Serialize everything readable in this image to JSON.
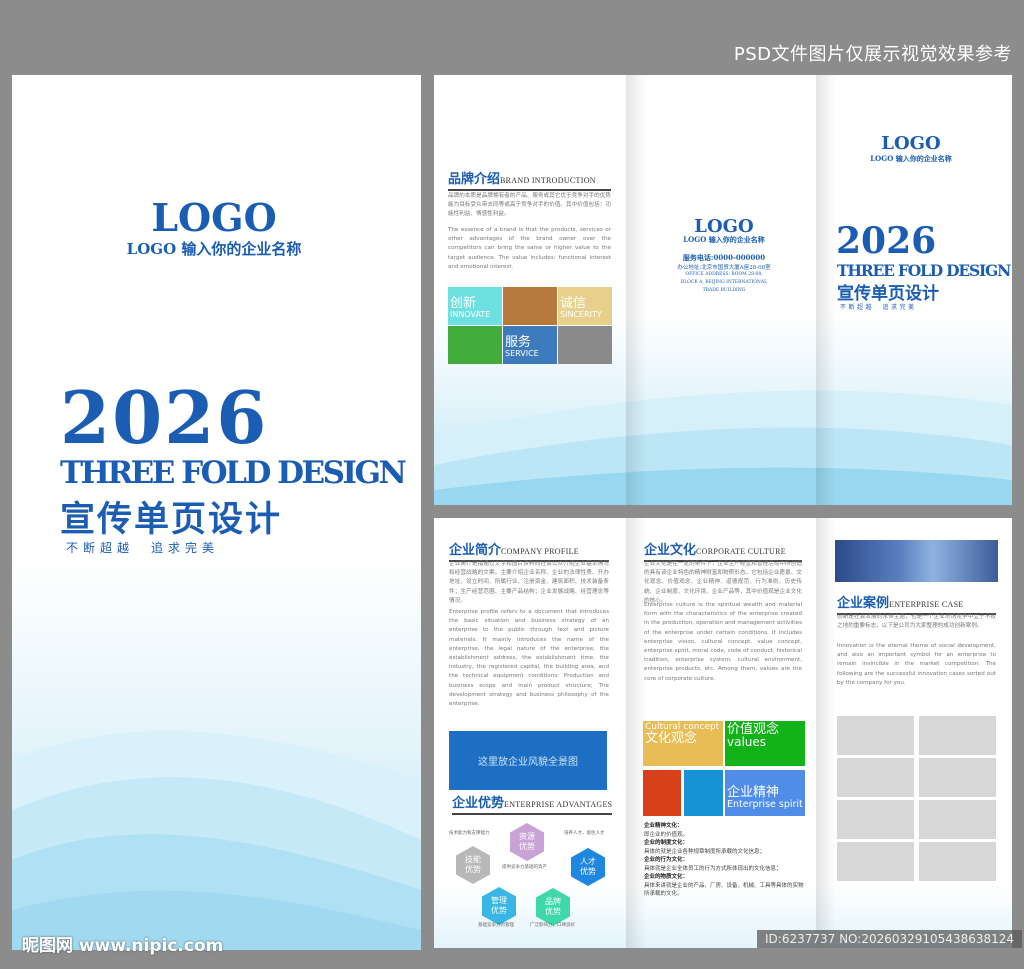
{
  "notice": "PSD文件图片仅展示视觉效果参考",
  "cover": {
    "logo": "LOGO",
    "company": "LOGO 输入你的企业名称",
    "year": "2026",
    "title_en": "THREE FOLD DESIGN",
    "title_cn": "宣传单页设计",
    "slogan": "不断超越　追求完美"
  },
  "outside": {
    "brand": {
      "title": "品牌介绍",
      "title_en": "BRAND INTRODUCTION",
      "text_cn": "品牌的本质是品牌拥有者的产品、服务或其它优于竞争对手的优势能为目标受众带去同等或高于竞争对手的价值。其中价值包括：功能性利益、情感性利益。",
      "text_en": "The essence of a brand is that the products, services or other advantages of the brand owner over the competitors can bring the same or higher value to the target audience. The value includes: functional interest and emotional interest.",
      "tiles": [
        {
          "cn": "创新",
          "en": "INNOVATE",
          "color": "#6fe0e2"
        },
        {
          "cn": "",
          "en": "",
          "color": "#b57a3c"
        },
        {
          "cn": "诚信",
          "en": "SINCERITY",
          "color": "#e6d08c"
        },
        {
          "cn": "",
          "en": "",
          "color": "#43ac3c"
        },
        {
          "cn": "服务",
          "en": "SERVICE",
          "color": "#3d7bbd"
        },
        {
          "cn": "",
          "en": "",
          "color": "#8a8a8a"
        }
      ]
    },
    "back": {
      "logo": "LOGO",
      "company": "LOGO 输入你的企业名称",
      "phone": "服务电话:0000-000000",
      "address_cn": "办公地址:北京市国贸大厦A座28-08室",
      "address_en": [
        "OFFICE ADDRESS: ROOM 28-08,",
        "BLOCK A, BEIJING INTERNATIONAL",
        "TRADE BUILDING"
      ]
    },
    "front": {
      "logo": "LOGO",
      "company": "LOGO 输入你的企业名称",
      "year": "2026",
      "title_en": "THREE FOLD DESIGN",
      "title_cn": "宣传单页设计",
      "slogan": "不断超越　追求完美"
    }
  },
  "inside": {
    "profile": {
      "title": "企业简介",
      "title_en": "COMPANY PROFILE",
      "text_cn": "企业简介是指通过文字和图片资料向社会公众介绍企业基本情况和经营战略的文案。主要介绍企业名称、企业的法律性质、开办地址、设立时间、所属行业、注册资金、建筑面积、技术装备条件；生产经营范围、主要产品结构；企业发展战略、经营理念等情况。",
      "text_en": "Enterprise profile refers to a document that introduces the basic situation and business strategy of an enterprise to the public through text and picture materials. It mainly introduces the name of the enterprise, the legal nature of the enterprise, the establishment address, the establishment time, the industry, the registered capital, the building area, and the technical equipment conditions; Production and business scope and main product structure; The development strategy and business philosophy of the enterprise.",
      "image_placeholder": "这里放企业风貌全景图"
    },
    "advantages": {
      "title": "企业优势",
      "title_en": "ENTERPRISE ADVANTAGES",
      "items": [
        {
          "label": "技能\n优势",
          "caption": "技术能力和支撑能力",
          "color": "#b8b8b8"
        },
        {
          "label": "资源\n优势",
          "caption": "提供竞争力基础的资产",
          "color": "#c9a3d6"
        },
        {
          "label": "人才\n优势",
          "caption": "培养人才，留住人才",
          "color": "#1e87e0"
        },
        {
          "label": "管理\n优势",
          "caption": "基础竞争力的管理",
          "color": "#39b6e3"
        },
        {
          "label": "品牌\n优势",
          "caption": "广泛影响力，口碑良好",
          "color": "#3fd8a8"
        }
      ]
    },
    "culture": {
      "title": "企业文化",
      "title_en": "CORPORATE CULTURE",
      "text_cn": "企业文化是在一定的条件下，企业生产经营和管理活动中所创造的具有该企业特色的精神财富和物质形态。它包括企业愿景、文化观念、价值观念、企业精神、道德规范、行为准则、历史传统、企业制度、文化环境、企业产品等，其中价值观是企业文化的核心。",
      "text_en": "Enterprise culture is the spiritual wealth and material form with the characteristics of the enterprise created in the production, operation and management activities of the enterprise under certain conditions. It includes enterprise vision, cultural concept, value concept, enterprise spirit, moral code, code of conduct, historical tradition, enterprise system, cultural environment, enterprise products, etc. Among them, values are the core of corporate culture.",
      "tiles": [
        {
          "en": "Cultural concept",
          "cn": "文化观念",
          "color": "#e8bd55"
        },
        {
          "cn": "价值观念",
          "en": "values",
          "color": "#12b318"
        },
        {
          "cn": "",
          "en": "",
          "color": "#d8401a"
        },
        {
          "cn": "",
          "en": "",
          "color": "#1692d6"
        },
        {
          "cn": "企业精神",
          "en": "Enterprise spirit",
          "color": "#4f8de8"
        }
      ],
      "list": [
        {
          "k": "企业精神文化：",
          "v": "即企业的价值观。"
        },
        {
          "k": "企业的制度文化：",
          "v": "具体的就是企业各种规章制度所承载的文化信息；"
        },
        {
          "k": "企业的行为文化：",
          "v": "具体就是企业全体员工的行为方式所体现出的文化信息；"
        },
        {
          "k": "企业的物质文化：",
          "v": "具体来讲就是企业的产品、厂房、设备、机械、工具等具体的实物所承载的文化。"
        }
      ]
    },
    "cases": {
      "title": "企业案例",
      "title_en": "ENTERPRISE CASE",
      "text_cn": "创新是社会发展的永恒主题，也是一个企业市场竞争中立于不败之地的重要标志，以下是公司为大家整理的成功创新案例。",
      "text_en": "Innovation is the eternal theme of social development, and also an important symbol for an enterprise to remain invincible in the market competition. The following are the successful innovation cases sorted out by the company for you."
    }
  },
  "watermark": "昵图网 www.nipic.com",
  "image_id": "ID:6237737 NO:20260329105438638124"
}
